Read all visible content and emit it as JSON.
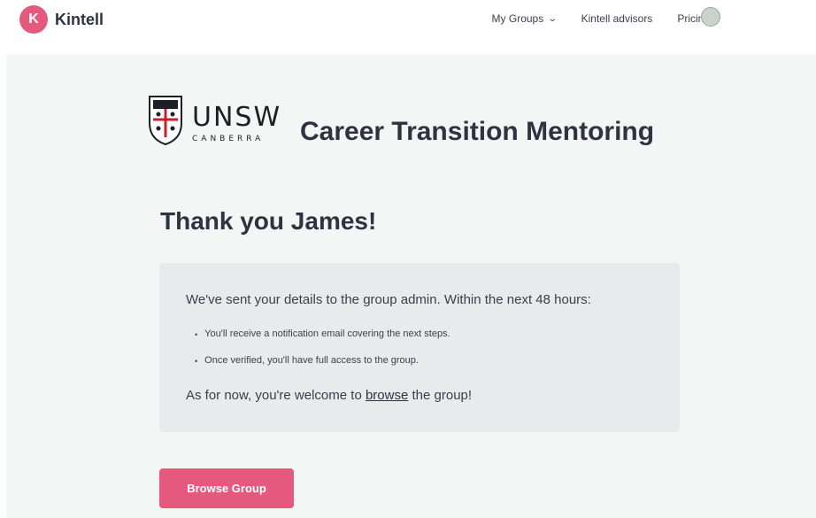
{
  "header": {
    "brand_initial": "K",
    "brand_name": "Kintell",
    "nav": [
      {
        "label": "My Groups",
        "has_dropdown": true
      },
      {
        "label": "Kintell advisors",
        "has_dropdown": false
      },
      {
        "label": "Pricing",
        "has_dropdown": false
      }
    ]
  },
  "group": {
    "logo_title": "UNSW",
    "logo_subtitle": "CANBERRA",
    "program_title": "Career Transition Mentoring"
  },
  "confirmation": {
    "heading": "Thank you James!",
    "lead": "We've sent your details to the group admin. Within the next 48 hours:",
    "bullets": [
      "You'll receive a notification email covering the next steps.",
      "Once verified, you'll have full access to the group."
    ],
    "foot_prefix": "As for now, you're welcome to ",
    "foot_link": "browse",
    "foot_suffix": " the group!"
  },
  "actions": {
    "browse_button": "Browse Group"
  },
  "colors": {
    "accent": "#e35a7d",
    "panel_bg": "#f4f6f6",
    "info_bg": "#e8eaec"
  }
}
